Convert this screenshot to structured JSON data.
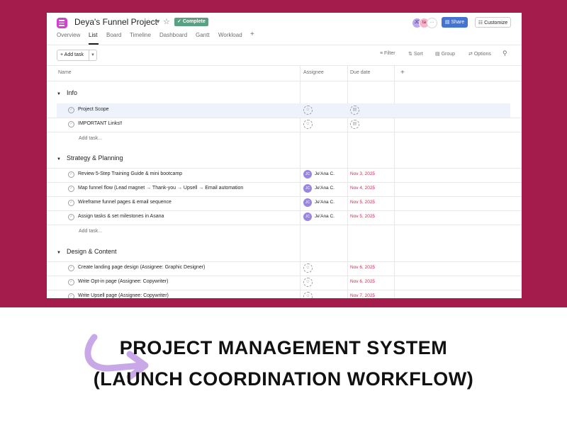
{
  "project": {
    "title": "Deya's Funnel Project",
    "status": "Complete",
    "status_color": "#58a182",
    "icon_color": "#d63dd3"
  },
  "header": {
    "avatars": [
      "JC",
      "ta",
      "···"
    ],
    "share_label": "Share",
    "customize_label": "Customize"
  },
  "tabs": [
    "Overview",
    "List",
    "Board",
    "Timeline",
    "Dashboard",
    "Gantt",
    "Workload",
    "+"
  ],
  "active_tab": "List",
  "toolbar": {
    "add_task": "+ Add task",
    "filter": "Filter",
    "sort": "Sort",
    "group": "Group",
    "options": "Options"
  },
  "columns": {
    "name": "Name",
    "assignee": "Assignee",
    "due_date": "Due date",
    "add": "+"
  },
  "sections": [
    {
      "name": "Info",
      "tasks": [
        {
          "name": "Project Scope",
          "assignee": "",
          "due": ""
        },
        {
          "name": "IMPORTANT Links!!",
          "assignee": "",
          "due": ""
        }
      ],
      "add_task": "Add task..."
    },
    {
      "name": "Strategy & Planning",
      "tasks": [
        {
          "name": "Review 5-Step Training Guide & mini bootcamp",
          "assignee": "Je'Ana C.",
          "initials": "JC",
          "due": "Nov 3, 2025"
        },
        {
          "name": "Map funnel flow (Lead magnet → Thank-you → Upsell → Email automation",
          "assignee": "Je'Ana C.",
          "initials": "JC",
          "due": "Nov 4, 2025"
        },
        {
          "name": "Wireframe funnel pages & email sequence",
          "assignee": "Je'Ana C.",
          "initials": "JC",
          "due": "Nov 5, 2025"
        },
        {
          "name": "Assign tasks & set milestones in Asana",
          "assignee": "Je'Ana C.",
          "initials": "JC",
          "due": "Nov 5, 2025"
        }
      ],
      "add_task": "Add task..."
    },
    {
      "name": "Design & Content",
      "tasks": [
        {
          "name": "Create landing page design (Assignee: Graphic Designer)",
          "assignee": "",
          "due": "Nov 6, 2025"
        },
        {
          "name": "Write Opt-in page (Assignee: Copywriter)",
          "assignee": "",
          "due": "Nov 6, 2025"
        },
        {
          "name": "Write Upsell page (Assignee: Copywriter)",
          "assignee": "",
          "due": "Nov 7, 2025"
        }
      ]
    }
  ],
  "caption": {
    "line1": "PROJECT MANAGEMENT SYSTEM",
    "line2": "(LAUNCH COORDINATION WORKFLOW)"
  },
  "colors": {
    "background": "#a31c4c",
    "accent_button": "#4573d2",
    "due_date": "#c92f54",
    "arrow": "#c9a8e8"
  }
}
